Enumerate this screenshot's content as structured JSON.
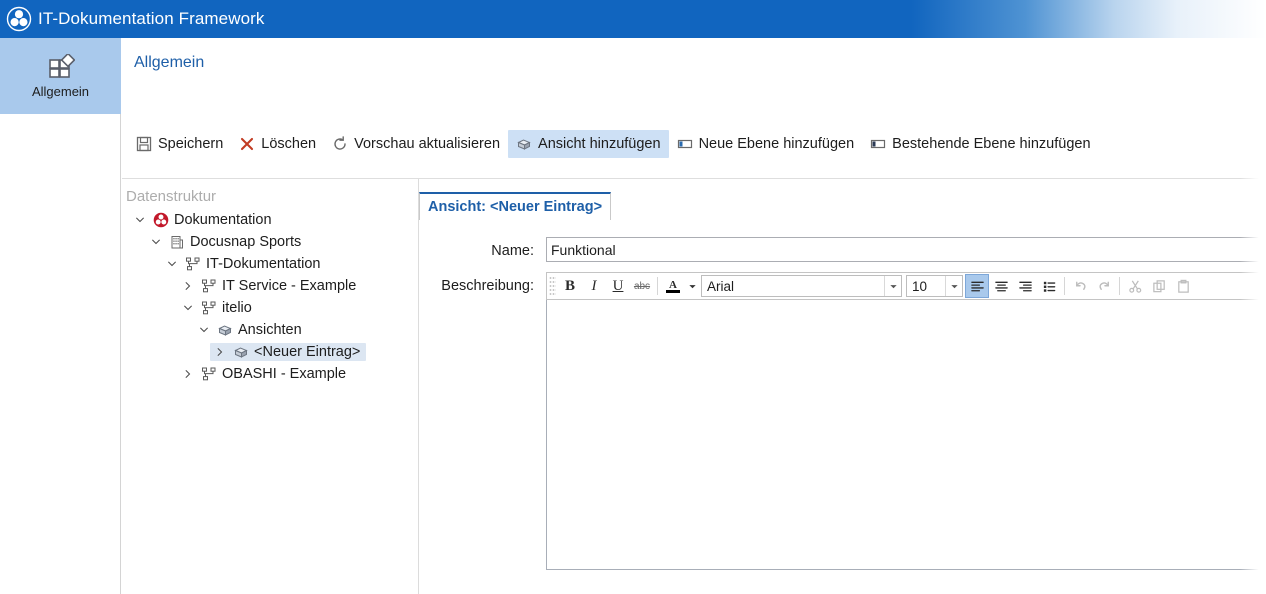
{
  "window": {
    "title": "IT-Dokumentation Framework",
    "logo_icon": "docusnap-logo-icon",
    "titlebar_color": "#1165bf"
  },
  "rail": {
    "items": [
      {
        "label": "Allgemein",
        "icon": "layout-grid-icon",
        "active": true
      }
    ]
  },
  "ribbon": {
    "title": "Allgemein",
    "buttons": [
      {
        "label": "Speichern",
        "icon": "save-floppy-icon",
        "active": false
      },
      {
        "label": "Löschen",
        "icon": "delete-x-icon",
        "active": false
      },
      {
        "label": "Vorschau aktualisieren",
        "icon": "refresh-circle-icon",
        "active": false
      },
      {
        "label": "Ansicht hinzufügen",
        "icon": "view-cube-icon",
        "active": true
      },
      {
        "label": "Neue Ebene hinzufügen",
        "icon": "new-layer-icon",
        "active": false
      },
      {
        "label": "Bestehende Ebene hinzufügen",
        "icon": "existing-layer-icon",
        "active": false
      }
    ]
  },
  "tree": {
    "header": "Datenstruktur",
    "nodes": [
      {
        "label": "Dokumentation",
        "depth": 0,
        "chevron": "down",
        "icon": "documentation-root-icon",
        "selected": false
      },
      {
        "label": "Docusnap Sports",
        "depth": 1,
        "chevron": "down",
        "icon": "company-building-icon",
        "selected": false
      },
      {
        "label": "IT-Dokumentation",
        "depth": 2,
        "chevron": "down",
        "icon": "structure-tree-icon",
        "selected": false
      },
      {
        "label": "IT Service - Example",
        "depth": 3,
        "chevron": "right",
        "icon": "structure-tree-icon",
        "selected": false
      },
      {
        "label": "itelio",
        "depth": 3,
        "chevron": "down",
        "icon": "structure-tree-icon",
        "selected": false
      },
      {
        "label": "Ansichten",
        "depth": 4,
        "chevron": "down",
        "icon": "view-cube-icon",
        "selected": false
      },
      {
        "label": "<Neuer Eintrag>",
        "depth": 5,
        "chevron": "right",
        "icon": "view-cube-icon",
        "selected": true
      },
      {
        "label": "OBASHI - Example",
        "depth": 3,
        "chevron": "right",
        "icon": "structure-tree-icon",
        "selected": false
      }
    ]
  },
  "detail": {
    "tab": {
      "label": "Ansicht: <Neuer Eintrag>"
    },
    "fields": {
      "name": {
        "label": "Name:",
        "value": "Funktional",
        "placeholder": ""
      },
      "description": {
        "label": "Beschreibung:",
        "value": ""
      }
    },
    "editor_toolbar": {
      "bold": {
        "glyph": "B",
        "name": "bold-icon",
        "state": "off"
      },
      "italic": {
        "glyph": "I",
        "name": "italic-icon",
        "state": "off"
      },
      "underline": {
        "glyph": "U",
        "name": "underline-icon",
        "state": "off"
      },
      "strikethrough": {
        "glyph": "abc",
        "name": "strikethrough-icon",
        "state": "off"
      },
      "font_color": {
        "glyph": "A",
        "name": "font-color-icon",
        "color": "#000000"
      },
      "font_family": {
        "value": "Arial"
      },
      "font_size": {
        "value": "10"
      },
      "align_left": {
        "name": "align-left-icon",
        "state": "on"
      },
      "align_center": {
        "name": "align-center-icon",
        "state": "off"
      },
      "align_right": {
        "name": "align-right-icon",
        "state": "off"
      },
      "bullet_list": {
        "name": "bullet-list-icon",
        "state": "off"
      },
      "undo": {
        "name": "undo-icon",
        "state": "disabled"
      },
      "redo": {
        "name": "redo-icon",
        "state": "disabled"
      },
      "cut": {
        "name": "cut-scissors-icon",
        "state": "disabled"
      },
      "copy": {
        "name": "copy-icon",
        "state": "disabled"
      },
      "paste": {
        "name": "paste-icon",
        "state": "disabled"
      }
    }
  }
}
